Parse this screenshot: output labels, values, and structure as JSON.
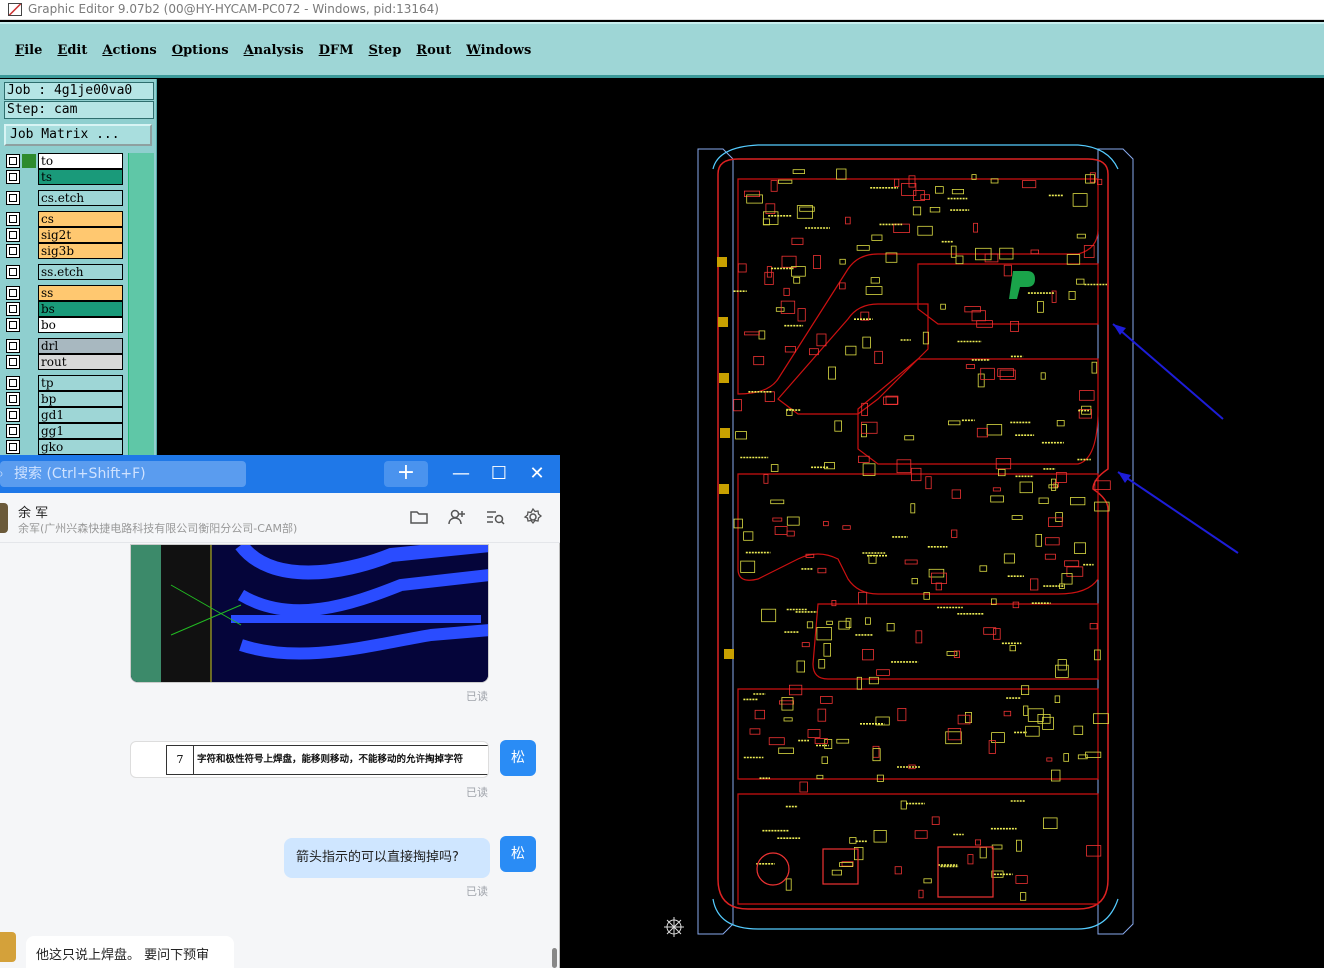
{
  "window": {
    "title": "Graphic Editor 9.07b2 (00@HY-HYCAM-PC072 - Windows, pid:13164)"
  },
  "menu": [
    "File",
    "Edit",
    "Actions",
    "Options",
    "Analysis",
    "DFM",
    "Step",
    "Rout",
    "Windows"
  ],
  "job_info": {
    "job": "Job : 4g1je00va0",
    "step": "Step: cam",
    "matrix_button": "Job Matrix ..."
  },
  "layers": [
    {
      "name": "to",
      "color": "#ffffff",
      "indicator": "#2e8b2e"
    },
    {
      "name": "ts",
      "color": "#1a9a7a",
      "indicator": ""
    },
    {
      "name": "cs.etch",
      "color": "#9ed6d6",
      "indicator": ""
    },
    {
      "name": "cs",
      "color": "#ffc870",
      "indicator": ""
    },
    {
      "name": "sig2t",
      "color": "#ffc870",
      "indicator": ""
    },
    {
      "name": "sig3b",
      "color": "#ffc870",
      "indicator": ""
    },
    {
      "name": "ss.etch",
      "color": "#9ed6d6",
      "indicator": ""
    },
    {
      "name": "ss",
      "color": "#ffc870",
      "indicator": ""
    },
    {
      "name": "bs",
      "color": "#1a9a7a",
      "indicator": ""
    },
    {
      "name": "bo",
      "color": "#ffffff",
      "indicator": ""
    },
    {
      "name": "drl",
      "color": "#a8b8c0",
      "indicator": ""
    },
    {
      "name": "rout",
      "color": "#d8d8d8",
      "indicator": ""
    },
    {
      "name": "tp",
      "color": "#9ed6d6",
      "indicator": ""
    },
    {
      "name": "bp",
      "color": "#9ed6d6",
      "indicator": ""
    },
    {
      "name": "gd1",
      "color": "#9ed6d6",
      "indicator": ""
    },
    {
      "name": "gg1",
      "color": "#9ed6d6",
      "indicator": ""
    },
    {
      "name": "gko",
      "color": "#9ed6d6",
      "indicator": ""
    }
  ],
  "chat": {
    "search_placeholder": "搜索 (Ctrl+Shift+F)",
    "add_label": "+",
    "minimize": "—",
    "maximize": "☐",
    "close": "✕",
    "contact_name": "余 军",
    "contact_org": "余军(广州兴森快捷电路科技有限公司衡阳分公司-CAM部)",
    "read_label": "已读",
    "table_num": "7",
    "table_text": "字符和极性符号上焊盘，能移则移动，不能移动的允许掏掉字符",
    "my_avatar": "松",
    "question": "箭头指示的可以直接掏掉吗?",
    "peer_reply": "他这只说上焊盘。 要问下预审"
  }
}
